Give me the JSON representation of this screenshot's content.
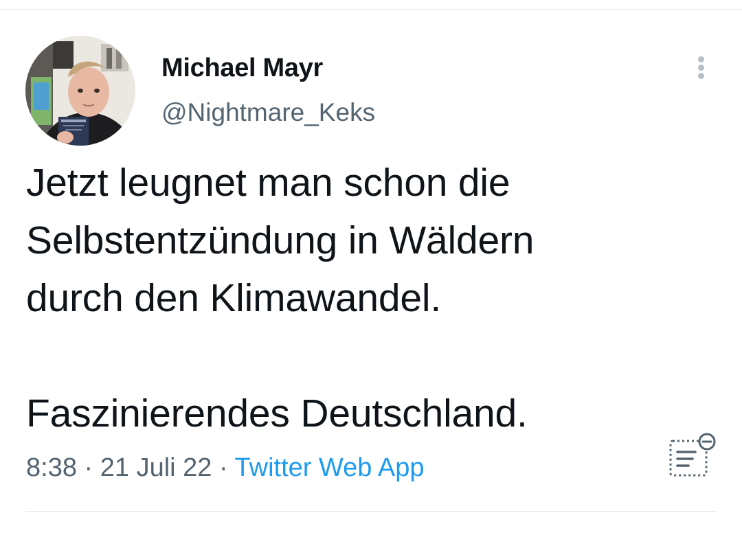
{
  "tweet": {
    "author": {
      "display_name": "Michael Mayr",
      "handle": "@Nightmare_Keks"
    },
    "text_lines_paragraph1": [
      "Jetzt leugnet man schon die",
      "Selbstentzündung in Wäldern",
      "durch den Klimawandel."
    ],
    "text_lines_paragraph2": [
      "Faszinierendes Deutschland."
    ],
    "time": "8:38",
    "separator": "·",
    "date": "21 Juli 22",
    "source": "Twitter Web App"
  },
  "icons": {
    "more": "more-vertical-icon",
    "notes": "birdwatch-notes-icon"
  },
  "colors": {
    "text_primary": "#0f1419",
    "text_secondary": "#536471",
    "link": "#1d9bf0",
    "divider": "#e6e9ec"
  }
}
